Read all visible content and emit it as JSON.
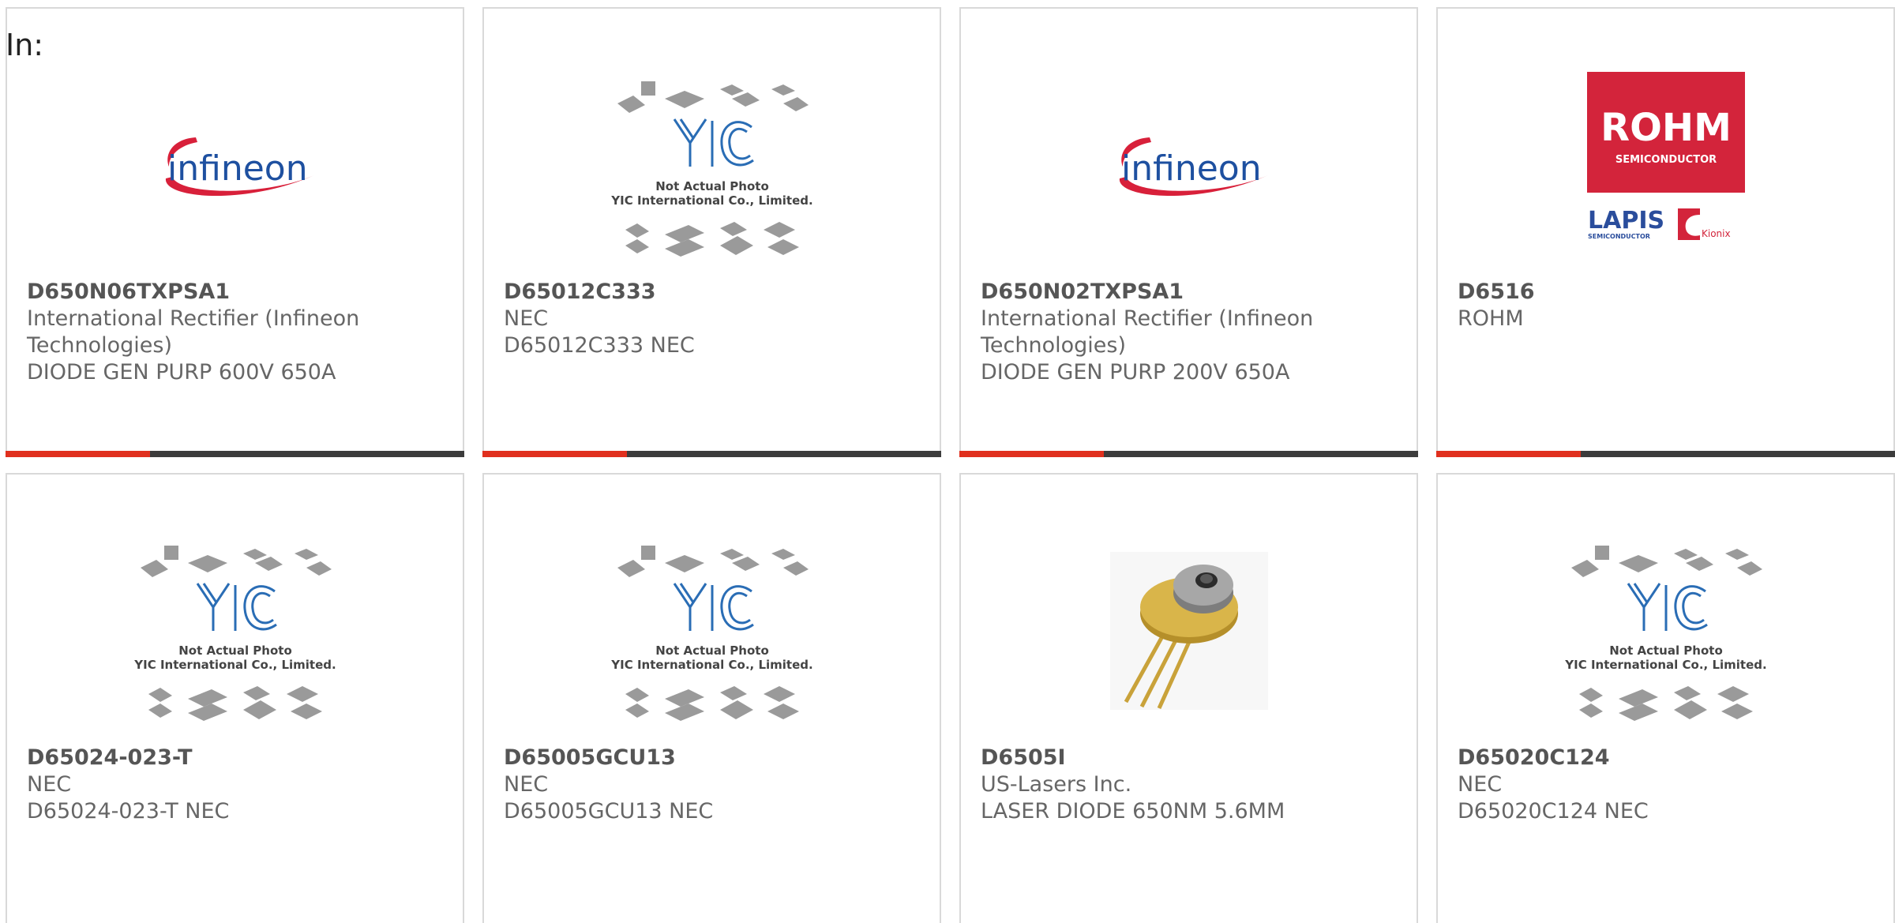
{
  "filter": {
    "label": "In:"
  },
  "products": [
    {
      "part_number": "D650N06TXPSA1",
      "manufacturer": "International Rectifier (Infineon Technologies)",
      "description": "DIODE GEN PURP 600V 650A",
      "image": "infineon-logo",
      "logo_text": "infineon"
    },
    {
      "part_number": "D65012C333",
      "manufacturer": "NEC",
      "description": "D65012C333 NEC",
      "image": "yic-placeholder",
      "placeholder": {
        "line1": "Not Actual Photo",
        "line2": "YIC International Co., Limited."
      }
    },
    {
      "part_number": "D650N02TXPSA1",
      "manufacturer": "International Rectifier (Infineon Technologies)",
      "description": "DIODE GEN PURP 200V 650A",
      "image": "infineon-logo",
      "logo_text": "infineon"
    },
    {
      "part_number": "D6516",
      "manufacturer": "ROHM",
      "description": "",
      "image": "rohm-logo",
      "logo_text": "ROHM",
      "logo_sub": "SEMICONDUCTOR",
      "logo_lapis": "LAPIS",
      "logo_lapis_sub": "SEMICONDUCTOR",
      "logo_kionix": "Kionix"
    },
    {
      "part_number": "D65024-023-T",
      "manufacturer": "NEC",
      "description": "D65024-023-T NEC",
      "image": "yic-placeholder",
      "placeholder": {
        "line1": "Not Actual Photo",
        "line2": "YIC International Co., Limited."
      }
    },
    {
      "part_number": "D65005GCU13",
      "manufacturer": "NEC",
      "description": "D65005GCU13 NEC",
      "image": "yic-placeholder",
      "placeholder": {
        "line1": "Not Actual Photo",
        "line2": "YIC International Co., Limited."
      }
    },
    {
      "part_number": "D6505I",
      "manufacturer": "US-Lasers Inc.",
      "description": "LASER DIODE 650NM 5.6MM",
      "image": "laser-diode-photo"
    },
    {
      "part_number": "D65020C124",
      "manufacturer": "NEC",
      "description": "D65020C124 NEC",
      "image": "yic-placeholder",
      "placeholder": {
        "line1": "Not Actual Photo",
        "line2": "YIC International Co., Limited."
      }
    }
  ],
  "colors": {
    "accent": "#e0301e",
    "bar": "#3c3c3c",
    "infineon_red": "#d8203a",
    "infineon_blue": "#1e50a0",
    "rohm_red": "#d3243b",
    "yic_blue": "#2a6db5"
  }
}
